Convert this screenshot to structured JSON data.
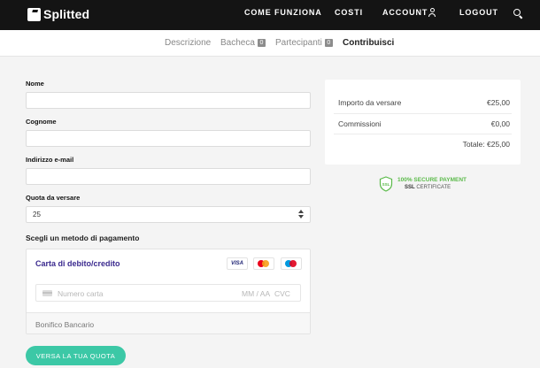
{
  "brand": {
    "name": "Splitted"
  },
  "nav": {
    "how_it_works": "COME FUNZIONA",
    "costs": "COSTI",
    "account": "ACCOUNT",
    "logout": "LOGOUT"
  },
  "tabs": [
    {
      "label": "Descrizione"
    },
    {
      "label": "Bacheca",
      "badge": "0"
    },
    {
      "label": "Partecipanti",
      "badge": "0"
    },
    {
      "label": "Contribuisci"
    }
  ],
  "form": {
    "name_label": "Nome",
    "surname_label": "Cognome",
    "email_label": "Indirizzo e-mail",
    "amount_label": "Quota da versare",
    "amount_value": "25",
    "payment_method_title": "Scegli un metodo di pagamento"
  },
  "payment": {
    "card_title": "Carta di debito/credito",
    "visa_label": "VISA",
    "card_number_placeholder": "Numero carta",
    "expiry_placeholder": "MM / AA",
    "cvc_placeholder": "CVC",
    "bank_transfer": "Bonifico Bancario"
  },
  "cta": {
    "label": "VERSA LA TUA QUOTA"
  },
  "summary": {
    "amount_label": "Importo da versare",
    "amount_value": "€25,00",
    "fees_label": "Commissioni",
    "fees_value": "€0,00",
    "total_label": "Totale:",
    "total_value": "€25,00"
  },
  "ssl": {
    "badge_text": "SSL",
    "line1": "100% SECURE PAYMENT",
    "line2_bold": "SSL",
    "line2_rest": "CERTIFICATE"
  },
  "colors": {
    "topbar": "#141414",
    "accent_green": "#3cc8a6",
    "card_title_purple": "#3b2a8f",
    "ssl_green": "#5bba4a"
  }
}
